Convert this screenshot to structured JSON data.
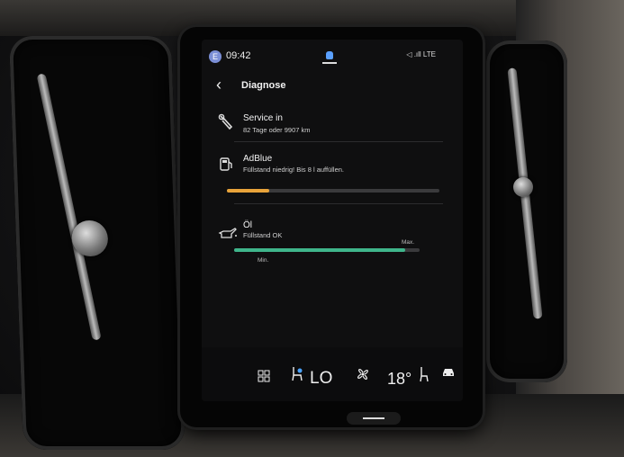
{
  "status": {
    "avatar_letter": "E",
    "time": "09:42",
    "network": "LTE",
    "signal_text": "◁ .ıll"
  },
  "header": {
    "back_symbol": "‹",
    "title": "Diagnose"
  },
  "items": [
    {
      "icon": "wrench-icon",
      "name": "Service in",
      "detail": "82 Tage oder 9907 km"
    },
    {
      "icon": "fuel-pump-icon",
      "name": "AdBlue",
      "detail": "Füllstand niedrig! Bis 8 l auffüllen.",
      "level": 0.2,
      "bar_color": "#e8a33a"
    },
    {
      "icon": "oil-can-icon",
      "name": "Öl",
      "detail": "Füllstand OK",
      "level": 0.92,
      "bar_color": "#3fb58b",
      "min_label": "Min.",
      "max_label": "Max."
    }
  ],
  "climate": {
    "home_icon": "grid-icon",
    "seat_heat_icon": "seat-heat-icon",
    "temp_left": "LO",
    "fan_icon": "fan-icon",
    "temp_right": "18°",
    "seat_icon": "seat-icon",
    "car_icon": "car-icon"
  }
}
